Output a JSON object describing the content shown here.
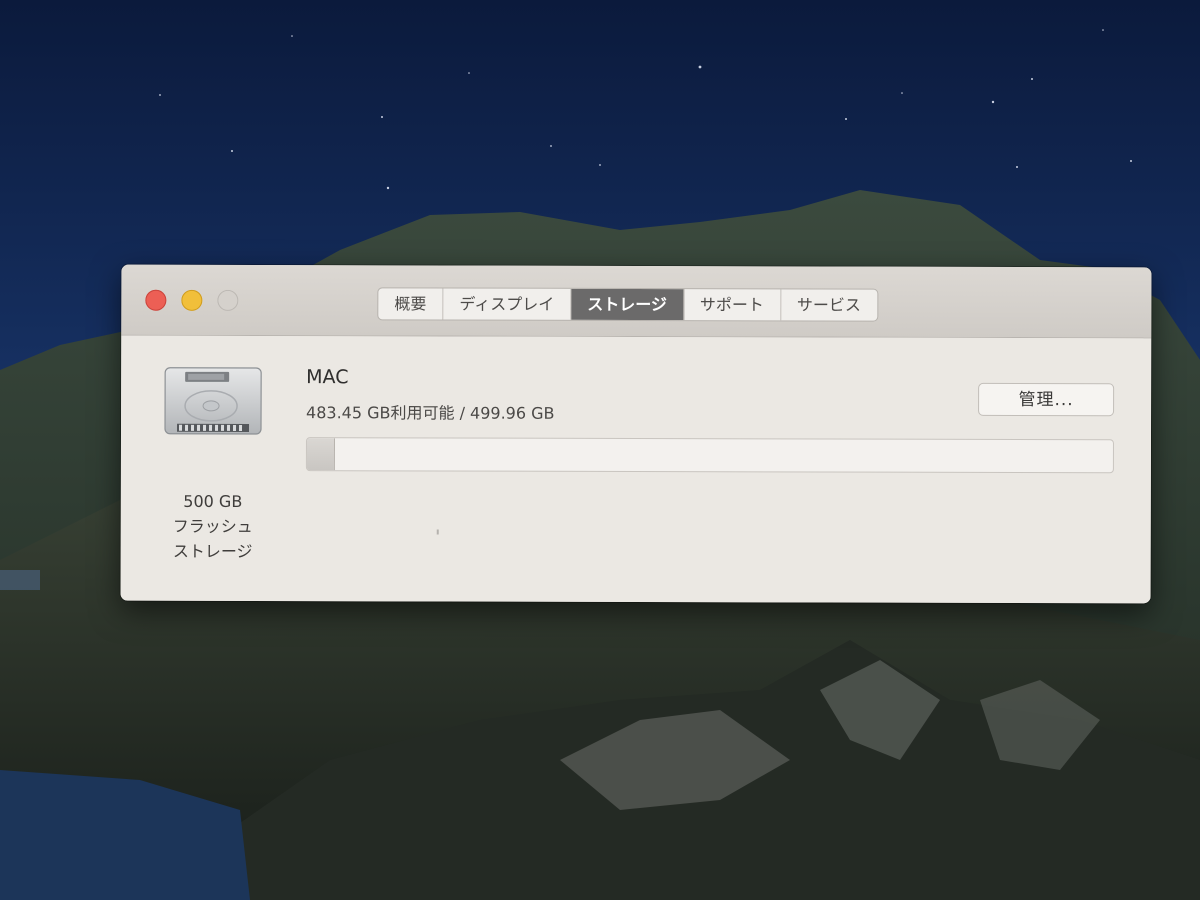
{
  "window": {
    "tabs": [
      {
        "label": "概要"
      },
      {
        "label": "ディスプレイ"
      },
      {
        "label": "ストレージ",
        "selected": true
      },
      {
        "label": "サポート"
      },
      {
        "label": "サービス"
      }
    ]
  },
  "disk": {
    "icon": "hard-drive-icon",
    "caption_line1": "500 GB",
    "caption_line2": "フラッシュ",
    "caption_line3": "ストレージ"
  },
  "volume": {
    "name": "MAC",
    "availability": "483.45 GB利用可能 / 499.96 GB",
    "used_fraction": 0.033
  },
  "buttons": {
    "manage": "管理..."
  },
  "colors": {
    "close": "#ec5f55",
    "minimize": "#f1bf3a",
    "selected_tab": "#6b6a6a"
  }
}
